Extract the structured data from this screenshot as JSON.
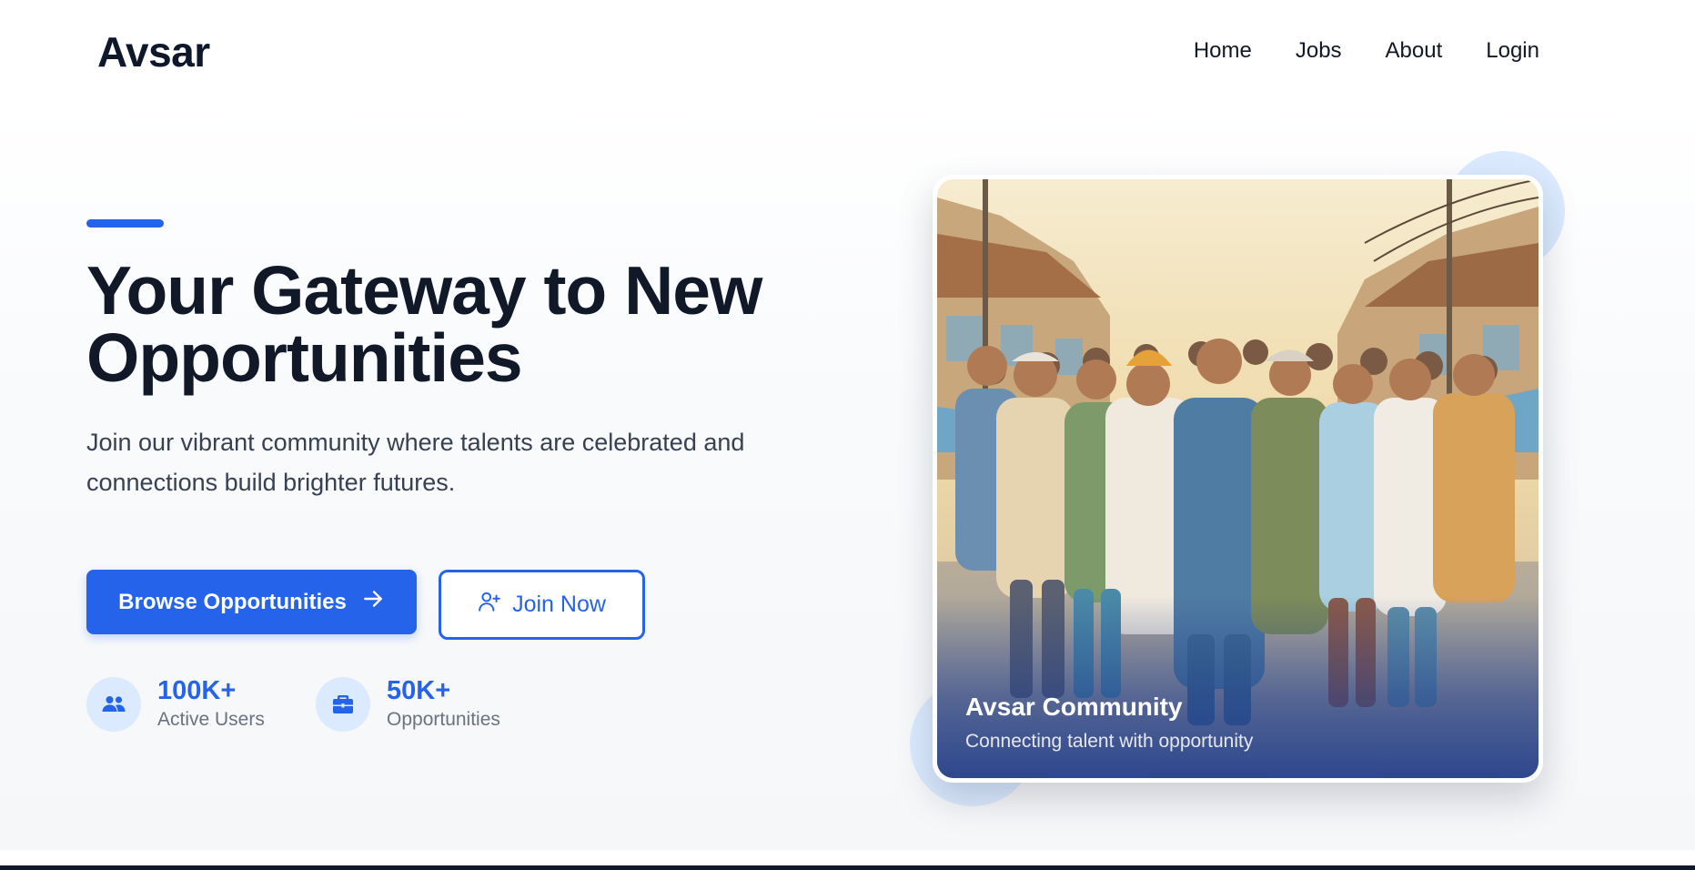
{
  "nav": {
    "brand": "Avsar",
    "links": [
      "Home",
      "Jobs",
      "About",
      "Login"
    ]
  },
  "hero": {
    "title": "Your Gateway to New Opportunities",
    "subtitle": "Join our vibrant community where talents are celebrated and connections build brighter futures.",
    "primary_button": "Browse Opportunities",
    "secondary_button": "Join Now",
    "stats": [
      {
        "value": "100K+",
        "label": "Active Users",
        "icon": "users-icon"
      },
      {
        "value": "50K+",
        "label": "Opportunities",
        "icon": "briefcase-icon"
      }
    ]
  },
  "image_card": {
    "caption_title": "Avsar Community",
    "caption_subtitle": "Connecting talent with opportunity"
  },
  "colors": {
    "accent": "#2563eb",
    "accent_light": "#dbeafe",
    "heading": "#111827",
    "body_text": "#374151",
    "muted": "#6b7280"
  }
}
